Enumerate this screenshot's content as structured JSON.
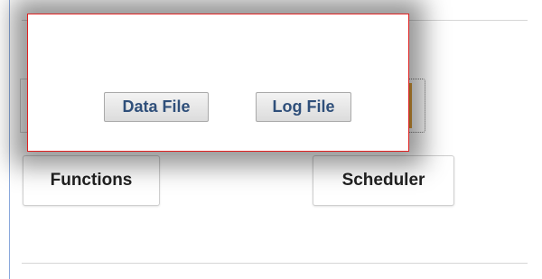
{
  "panel": {
    "buttons": {
      "functions_label": "Functions",
      "scheduler_label": "Scheduler"
    }
  },
  "popup": {
    "data_file_label": "Data File",
    "log_file_label": "Log File"
  },
  "colors": {
    "popup_border": "#e02020",
    "panel_border": "#8aa8dc",
    "link_text": "#2f4f7a",
    "accent": "#e2a23a"
  }
}
